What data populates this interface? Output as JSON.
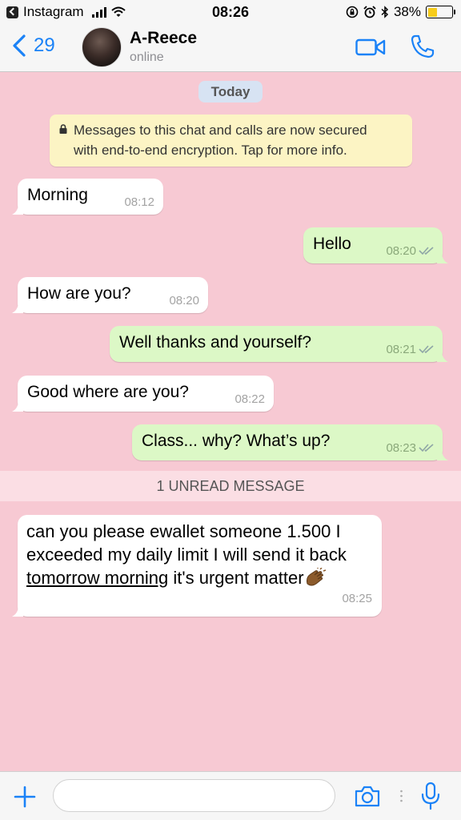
{
  "status_bar": {
    "app": "Instagram",
    "time": "08:26",
    "battery": "38%",
    "battery_level": 0.38
  },
  "header": {
    "back_count": "29",
    "contact_name": "A-Reece",
    "contact_status": "online",
    "icons": [
      "chevron-left-icon",
      "video-camera-icon",
      "phone-icon"
    ]
  },
  "chat": {
    "date_label": "Today",
    "encryption_line1": "Messages to this chat and calls are now secured",
    "encryption_line2": "with end-to-end encryption. Tap for more info.",
    "messages": [
      {
        "direction": "in",
        "text": "Morning",
        "time": "08:12"
      },
      {
        "direction": "out",
        "text": "Hello",
        "time": "08:20",
        "status": "read"
      },
      {
        "direction": "in",
        "text": "How are you?",
        "time": "08:20"
      },
      {
        "direction": "out",
        "text": "Well thanks and yourself?",
        "time": "08:21",
        "status": "read"
      },
      {
        "direction": "in",
        "text": "Good where are you?",
        "time": "08:22"
      },
      {
        "direction": "out",
        "text": "Class... why? What’s up?",
        "time": "08:23",
        "status": "read"
      }
    ],
    "unread_label": "1 UNREAD MESSAGE",
    "last_message": {
      "line1": "can you please ewallet someone 1.500 I",
      "line2": "exceeded my daily limit I will send it back",
      "line3_link": "tomorrow morning",
      "line3_rest": " it's urgent matter",
      "emoji": "clapping-hands-icon",
      "time": "08:25"
    }
  },
  "input_bar": {
    "placeholder": "",
    "icons": [
      "plus-icon",
      "camera-icon",
      "microphone-icon"
    ]
  },
  "colors": {
    "chat_background": "#f7c9d3",
    "outgoing_bubble": "#dcf8c6",
    "incoming_bubble": "#ffffff",
    "accent": "#1a82f7",
    "encryption_notice": "#fcf4c4",
    "date_pill": "#d7e3f3",
    "battery_fill": "#f7cc1a"
  }
}
